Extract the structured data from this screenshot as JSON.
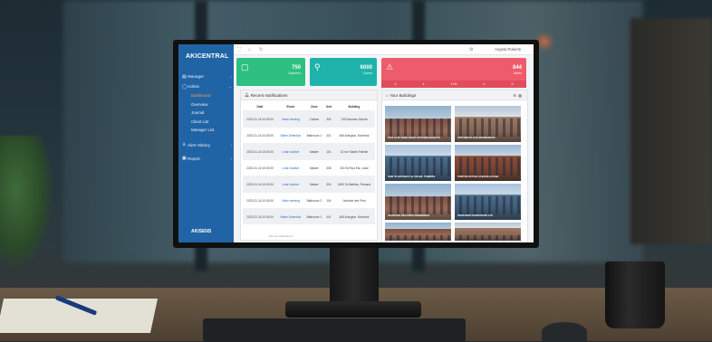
{
  "app": {
    "logo": "AKICENTRAL",
    "footer_logo": "AKISENS"
  },
  "sidebar": {
    "items": [
      {
        "icon": "manager-icon",
        "label": "Manager"
      },
      {
        "icon": "admin-icon",
        "label": "Admin"
      },
      {
        "icon": "alert-icon",
        "label": "Alert History"
      },
      {
        "icon": "report-icon",
        "label": "Report"
      }
    ],
    "subitems": [
      "Dashboard",
      "Overview",
      "Journal",
      "Client List",
      "Manager List"
    ],
    "active_subitem": "Dashboard"
  },
  "topbar": {
    "user_name": "Angela Roberts"
  },
  "cards": {
    "green": {
      "value": "750",
      "caption": "Systems",
      "color": "#2ebf82"
    },
    "teal": {
      "value": "6000",
      "caption": "Zones",
      "color": "#1eb3aa"
    },
    "red": {
      "value": "844",
      "caption": "Alerts",
      "color": "#ee5b6b",
      "strip": [
        "2",
        "4",
        "1:00",
        "0",
        "9"
      ]
    }
  },
  "notifications": {
    "title": "Recent Notifications",
    "columns": [
      "Date",
      "Event",
      "Zone",
      "Unit",
      "Building"
    ],
    "rows": [
      {
        "date": "2022-01-16 10:00:00",
        "event": "Valve warning",
        "zone": "Cuisine",
        "unit": "304",
        "building": "749 Nouveau Monde"
      },
      {
        "date": "2022-01-16 10:00:00",
        "event": "Water Detection",
        "zone": "Bathroom 1",
        "unit": "401",
        "building": "486 Arlington, Montréal"
      },
      {
        "date": "2022-01-16 10:00:00",
        "event": "Leak Inactive",
        "zone": "Master",
        "unit": "101",
        "building": "10 rue Sainte-Famille"
      },
      {
        "date": "2022-01-16 10:00:00",
        "event": "Leak Inactive",
        "zone": "Master",
        "unit": "308",
        "building": "330 St-Paul Est, Laval"
      },
      {
        "date": "2022-01-16 10:00:00",
        "event": "Leak Inactive",
        "zone": "Master",
        "unit": "304",
        "building": "1680 St-Mathieu, Renaud"
      },
      {
        "date": "2022-01-16 10:00:00",
        "event": "Valve warning",
        "zone": "Bathroom 2",
        "unit": "104",
        "building": "Jacinthe des Prés"
      },
      {
        "date": "2022-01-16 10:00:00",
        "event": "Water Detection",
        "zone": "Bathroom 1",
        "unit": "401",
        "building": "486 Arlington, Montréal"
      }
    ],
    "footer": "View all notifications"
  },
  "buildings": {
    "title": "Your Buildings",
    "items": [
      "2712 ALTA PARK ROAD UPTOWN HEIGHTS",
      "UPTOWN PLACE RESIDENCES",
      "1080 ST-MATHIEU LE SOLEIL TOWERS",
      "PORTER SUITES AVENUE HOUSE",
      "JACINTHE DES PRÉS RESIDENCE",
      "PARKVIEW DOWNTOWN 4TH",
      "",
      ""
    ]
  }
}
